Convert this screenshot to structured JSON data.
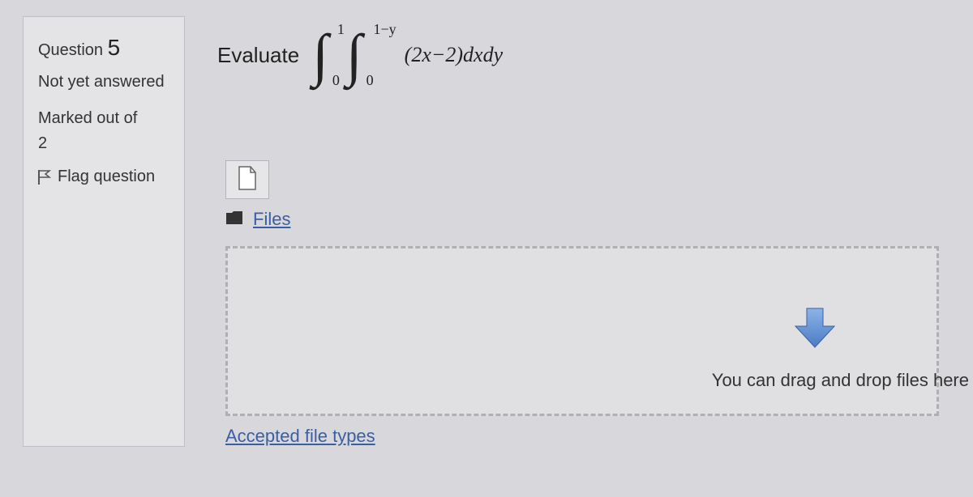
{
  "sidebar": {
    "question_label": "Question",
    "question_number": "5",
    "status": "Not yet answered",
    "marked_label": "Marked out of",
    "marked_value": "2",
    "flag_label": "Flag question"
  },
  "main": {
    "prompt": "Evaluate",
    "integral": {
      "outer_lower": "0",
      "outer_upper": "1",
      "inner_lower": "0",
      "inner_upper": "1−y",
      "integrand": "(2x−2)dxdy"
    }
  },
  "files": {
    "link_label": "Files",
    "dropzone_text": "You can drag and drop files here",
    "accepted_label": "Accepted file types"
  }
}
